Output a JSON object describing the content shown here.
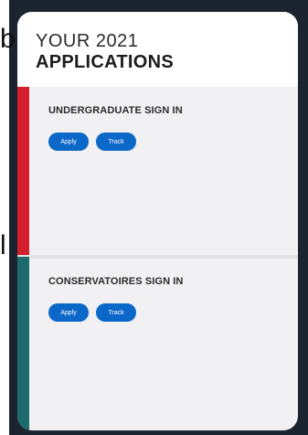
{
  "background_fragments": [
    "b",
    "l"
  ],
  "card": {
    "title_line1": "YOUR 2021",
    "title_line2": "APPLICATIONS"
  },
  "sections": [
    {
      "label": "UNDERGRADUATE SIGN IN",
      "accent_color": "#d4202c",
      "buttons": [
        "Apply",
        "Track"
      ]
    },
    {
      "label": "CONSERVATOIRES SIGN IN",
      "accent_color": "#1e6b6d",
      "buttons": [
        "Apply",
        "Track"
      ]
    }
  ],
  "colors": {
    "button": "#0b67c8",
    "card_background": "#f1f0f3",
    "page_background": "#1c2430"
  }
}
